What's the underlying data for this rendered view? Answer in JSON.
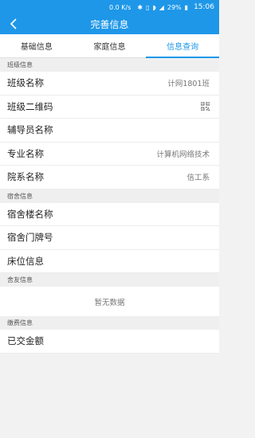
{
  "status_bar": {
    "speed": "0.0 K/s",
    "battery": "29%",
    "time": "15:06"
  },
  "header": {
    "title": "完善信息",
    "back_icon": "chevron-left-icon"
  },
  "tabs": [
    {
      "label": "基础信息",
      "active": false
    },
    {
      "label": "家庭信息",
      "active": false
    },
    {
      "label": "信息查询",
      "active": true
    }
  ],
  "class_section": {
    "title": "班级信息",
    "rows": {
      "class_name": {
        "label": "班级名称",
        "value": "计网1801班"
      },
      "class_qr": {
        "label": "班级二维码",
        "icon": "qr-code-icon"
      },
      "counselor": {
        "label": "辅导员名称",
        "value": ""
      },
      "major": {
        "label": "专业名称",
        "value": "计算机网络技术"
      },
      "department": {
        "label": "院系名称",
        "value": "信工系"
      }
    }
  },
  "dorm_section": {
    "title": "宿舍信息",
    "rows": {
      "building": {
        "label": "宿舍楼名称",
        "value": ""
      },
      "room": {
        "label": "宿舍门牌号",
        "value": ""
      },
      "bed": {
        "label": "床位信息",
        "value": ""
      }
    }
  },
  "roommate_section": {
    "title": "舍友信息",
    "empty_text": "暂无数据"
  },
  "payment_section": {
    "title": "缴费信息",
    "rows": {
      "paid_amount": {
        "label": "已交金额",
        "value": ""
      }
    }
  },
  "colors": {
    "accent": "#1e97e8",
    "background": "#f2f2f2"
  }
}
